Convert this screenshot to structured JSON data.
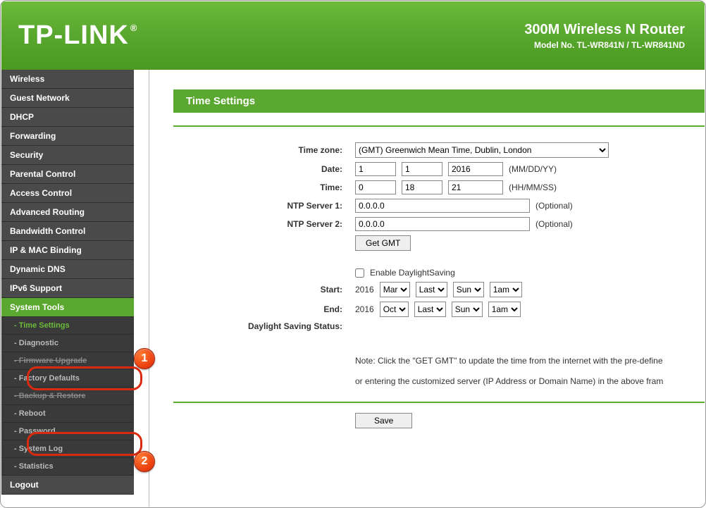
{
  "header": {
    "logo": "TP-LINK",
    "title": "300M Wireless N Router",
    "model": "Model No. TL-WR841N / TL-WR841ND"
  },
  "sidebar": {
    "items": [
      {
        "label": "Wireless",
        "type": "main"
      },
      {
        "label": "Guest Network",
        "type": "main"
      },
      {
        "label": "DHCP",
        "type": "main"
      },
      {
        "label": "Forwarding",
        "type": "main"
      },
      {
        "label": "Security",
        "type": "main"
      },
      {
        "label": "Parental Control",
        "type": "main"
      },
      {
        "label": "Access Control",
        "type": "main"
      },
      {
        "label": "Advanced Routing",
        "type": "main"
      },
      {
        "label": "Bandwidth Control",
        "type": "main"
      },
      {
        "label": "IP & MAC Binding",
        "type": "main"
      },
      {
        "label": "Dynamic DNS",
        "type": "main"
      },
      {
        "label": "IPv6 Support",
        "type": "main"
      },
      {
        "label": "System Tools",
        "type": "main",
        "active": true
      },
      {
        "label": "- Time Settings",
        "type": "sub",
        "highlight": true
      },
      {
        "label": "- Diagnostic",
        "type": "sub"
      },
      {
        "label": "- Firmware Upgrade",
        "type": "sub",
        "struck": true
      },
      {
        "label": "- Factory Defaults",
        "type": "sub"
      },
      {
        "label": "- Backup & Restore",
        "type": "sub",
        "struck": true
      },
      {
        "label": "- Reboot",
        "type": "sub"
      },
      {
        "label": "- Password",
        "type": "sub"
      },
      {
        "label": "- System Log",
        "type": "sub"
      },
      {
        "label": "- Statistics",
        "type": "sub"
      },
      {
        "label": "Logout",
        "type": "main"
      }
    ]
  },
  "badges": {
    "one": "1",
    "two": "2"
  },
  "panel": {
    "title": "Time Settings"
  },
  "form": {
    "timezone_label": "Time zone:",
    "timezone_value": "(GMT) Greenwich Mean Time, Dublin, London",
    "date_label": "Date:",
    "date_mm": "1",
    "date_dd": "1",
    "date_yy": "2016",
    "date_hint": "(MM/DD/YY)",
    "time_label": "Time:",
    "time_hh": "0",
    "time_mm": "18",
    "time_ss": "21",
    "time_hint": "(HH/MM/SS)",
    "ntp1_label": "NTP Server 1:",
    "ntp1_value": "0.0.0.0",
    "ntp1_hint": "(Optional)",
    "ntp2_label": "NTP Server 2:",
    "ntp2_value": "0.0.0.0",
    "ntp2_hint": "(Optional)",
    "get_gmt": "Get GMT",
    "daylight_enable": "Enable DaylightSaving",
    "start_label": "Start:",
    "start_year": "2016",
    "start_month": "Mar",
    "start_week": "Last",
    "start_day": "Sun",
    "start_hour": "1am",
    "end_label": "End:",
    "end_year": "2016",
    "end_month": "Oct",
    "end_week": "Last",
    "end_day": "Sun",
    "end_hour": "1am",
    "dss_label": "Daylight Saving Status:",
    "note1": "Note: Click the \"GET GMT\" to update the time from the internet with the pre-define",
    "note2": "or entering the customized server (IP Address or Domain Name) in the above fram",
    "save": "Save"
  }
}
